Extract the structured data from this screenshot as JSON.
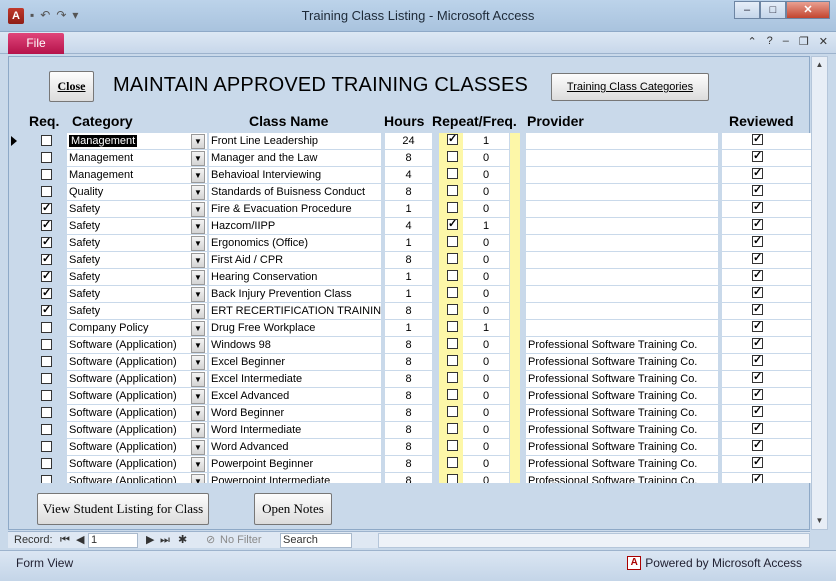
{
  "window": {
    "title": "Training Class Listing  -  Microsoft Access",
    "app_icon": "A"
  },
  "ribbon": {
    "file_tab": "File"
  },
  "form": {
    "close_label": "Close",
    "title": "MAINTAIN APPROVED TRAINING CLASSES",
    "categories_label": "Training Class Categories",
    "headers": {
      "req": "Req.",
      "category": "Category",
      "class_name": "Class Name",
      "hours": "Hours",
      "repeat": "Repeat/Freq.",
      "provider": "Provider",
      "reviewed": "Reviewed"
    },
    "view_students_label": "View Student Listing for Class",
    "open_notes_label": "Open Notes"
  },
  "rows": [
    {
      "req": false,
      "category": "Management",
      "class": "Front Line Leadership",
      "hours": "24",
      "repeat": true,
      "freq": "1",
      "provider": "",
      "reviewed": true
    },
    {
      "req": false,
      "category": "Management",
      "class": "Manager and the Law",
      "hours": "8",
      "repeat": false,
      "freq": "0",
      "provider": "",
      "reviewed": true
    },
    {
      "req": false,
      "category": "Management",
      "class": "Behavioal Interviewing",
      "hours": "4",
      "repeat": false,
      "freq": "0",
      "provider": "",
      "reviewed": true
    },
    {
      "req": false,
      "category": "Quality",
      "class": "Standards of Buisness Conduct",
      "hours": "8",
      "repeat": false,
      "freq": "0",
      "provider": "",
      "reviewed": true
    },
    {
      "req": true,
      "category": "Safety",
      "class": "Fire & Evacuation Procedure",
      "hours": "1",
      "repeat": false,
      "freq": "0",
      "provider": "",
      "reviewed": true
    },
    {
      "req": true,
      "category": "Safety",
      "class": "Hazcom/IIPP",
      "hours": "4",
      "repeat": true,
      "freq": "1",
      "provider": "",
      "reviewed": true
    },
    {
      "req": true,
      "category": "Safety",
      "class": "Ergonomics (Office)",
      "hours": "1",
      "repeat": false,
      "freq": "0",
      "provider": "",
      "reviewed": true
    },
    {
      "req": true,
      "category": "Safety",
      "class": "First Aid / CPR",
      "hours": "8",
      "repeat": false,
      "freq": "0",
      "provider": "",
      "reviewed": true
    },
    {
      "req": true,
      "category": "Safety",
      "class": "Hearing Conservation",
      "hours": "1",
      "repeat": false,
      "freq": "0",
      "provider": "",
      "reviewed": true
    },
    {
      "req": true,
      "category": "Safety",
      "class": "Back Injury Prevention Class",
      "hours": "1",
      "repeat": false,
      "freq": "0",
      "provider": "",
      "reviewed": true
    },
    {
      "req": true,
      "category": "Safety",
      "class": "ERT RECERTIFICATION TRAINING",
      "hours": "8",
      "repeat": false,
      "freq": "0",
      "provider": "",
      "reviewed": true
    },
    {
      "req": false,
      "category": "Company Policy",
      "class": "Drug Free Workplace",
      "hours": "1",
      "repeat": false,
      "freq": "1",
      "provider": "",
      "reviewed": true
    },
    {
      "req": false,
      "category": "Software (Application)",
      "class": "Windows 98",
      "hours": "8",
      "repeat": false,
      "freq": "0",
      "provider": "Professional Software Training Co.",
      "reviewed": true
    },
    {
      "req": false,
      "category": "Software (Application)",
      "class": "Excel Beginner",
      "hours": "8",
      "repeat": false,
      "freq": "0",
      "provider": "Professional Software Training Co.",
      "reviewed": true
    },
    {
      "req": false,
      "category": "Software (Application)",
      "class": "Excel Intermediate",
      "hours": "8",
      "repeat": false,
      "freq": "0",
      "provider": "Professional Software Training Co.",
      "reviewed": true
    },
    {
      "req": false,
      "category": "Software (Application)",
      "class": "Excel Advanced",
      "hours": "8",
      "repeat": false,
      "freq": "0",
      "provider": "Professional Software Training Co.",
      "reviewed": true
    },
    {
      "req": false,
      "category": "Software (Application)",
      "class": "Word Beginner",
      "hours": "8",
      "repeat": false,
      "freq": "0",
      "provider": "Professional Software Training Co.",
      "reviewed": true
    },
    {
      "req": false,
      "category": "Software (Application)",
      "class": "Word Intermediate",
      "hours": "8",
      "repeat": false,
      "freq": "0",
      "provider": "Professional Software Training Co.",
      "reviewed": true
    },
    {
      "req": false,
      "category": "Software (Application)",
      "class": "Word Advanced",
      "hours": "8",
      "repeat": false,
      "freq": "0",
      "provider": "Professional Software Training Co.",
      "reviewed": true
    },
    {
      "req": false,
      "category": "Software (Application)",
      "class": "Powerpoint Beginner",
      "hours": "8",
      "repeat": false,
      "freq": "0",
      "provider": "Professional Software Training Co.",
      "reviewed": true
    },
    {
      "req": false,
      "category": "Software (Application)",
      "class": "Powerpoint Intermediate",
      "hours": "8",
      "repeat": false,
      "freq": "0",
      "provider": "Professional Software Training Co.",
      "reviewed": true
    }
  ],
  "navbar": {
    "record_label": "Record:",
    "record_value": "1",
    "filter_label": "No Filter",
    "search_label": "Search"
  },
  "status": {
    "left": "Form View",
    "right": "Powered by Microsoft Access",
    "logo_letter": "A"
  },
  "colors": {
    "accent": "#b5124a",
    "field_yellow": "#fdf7a8",
    "background": "#c9d9ea"
  }
}
